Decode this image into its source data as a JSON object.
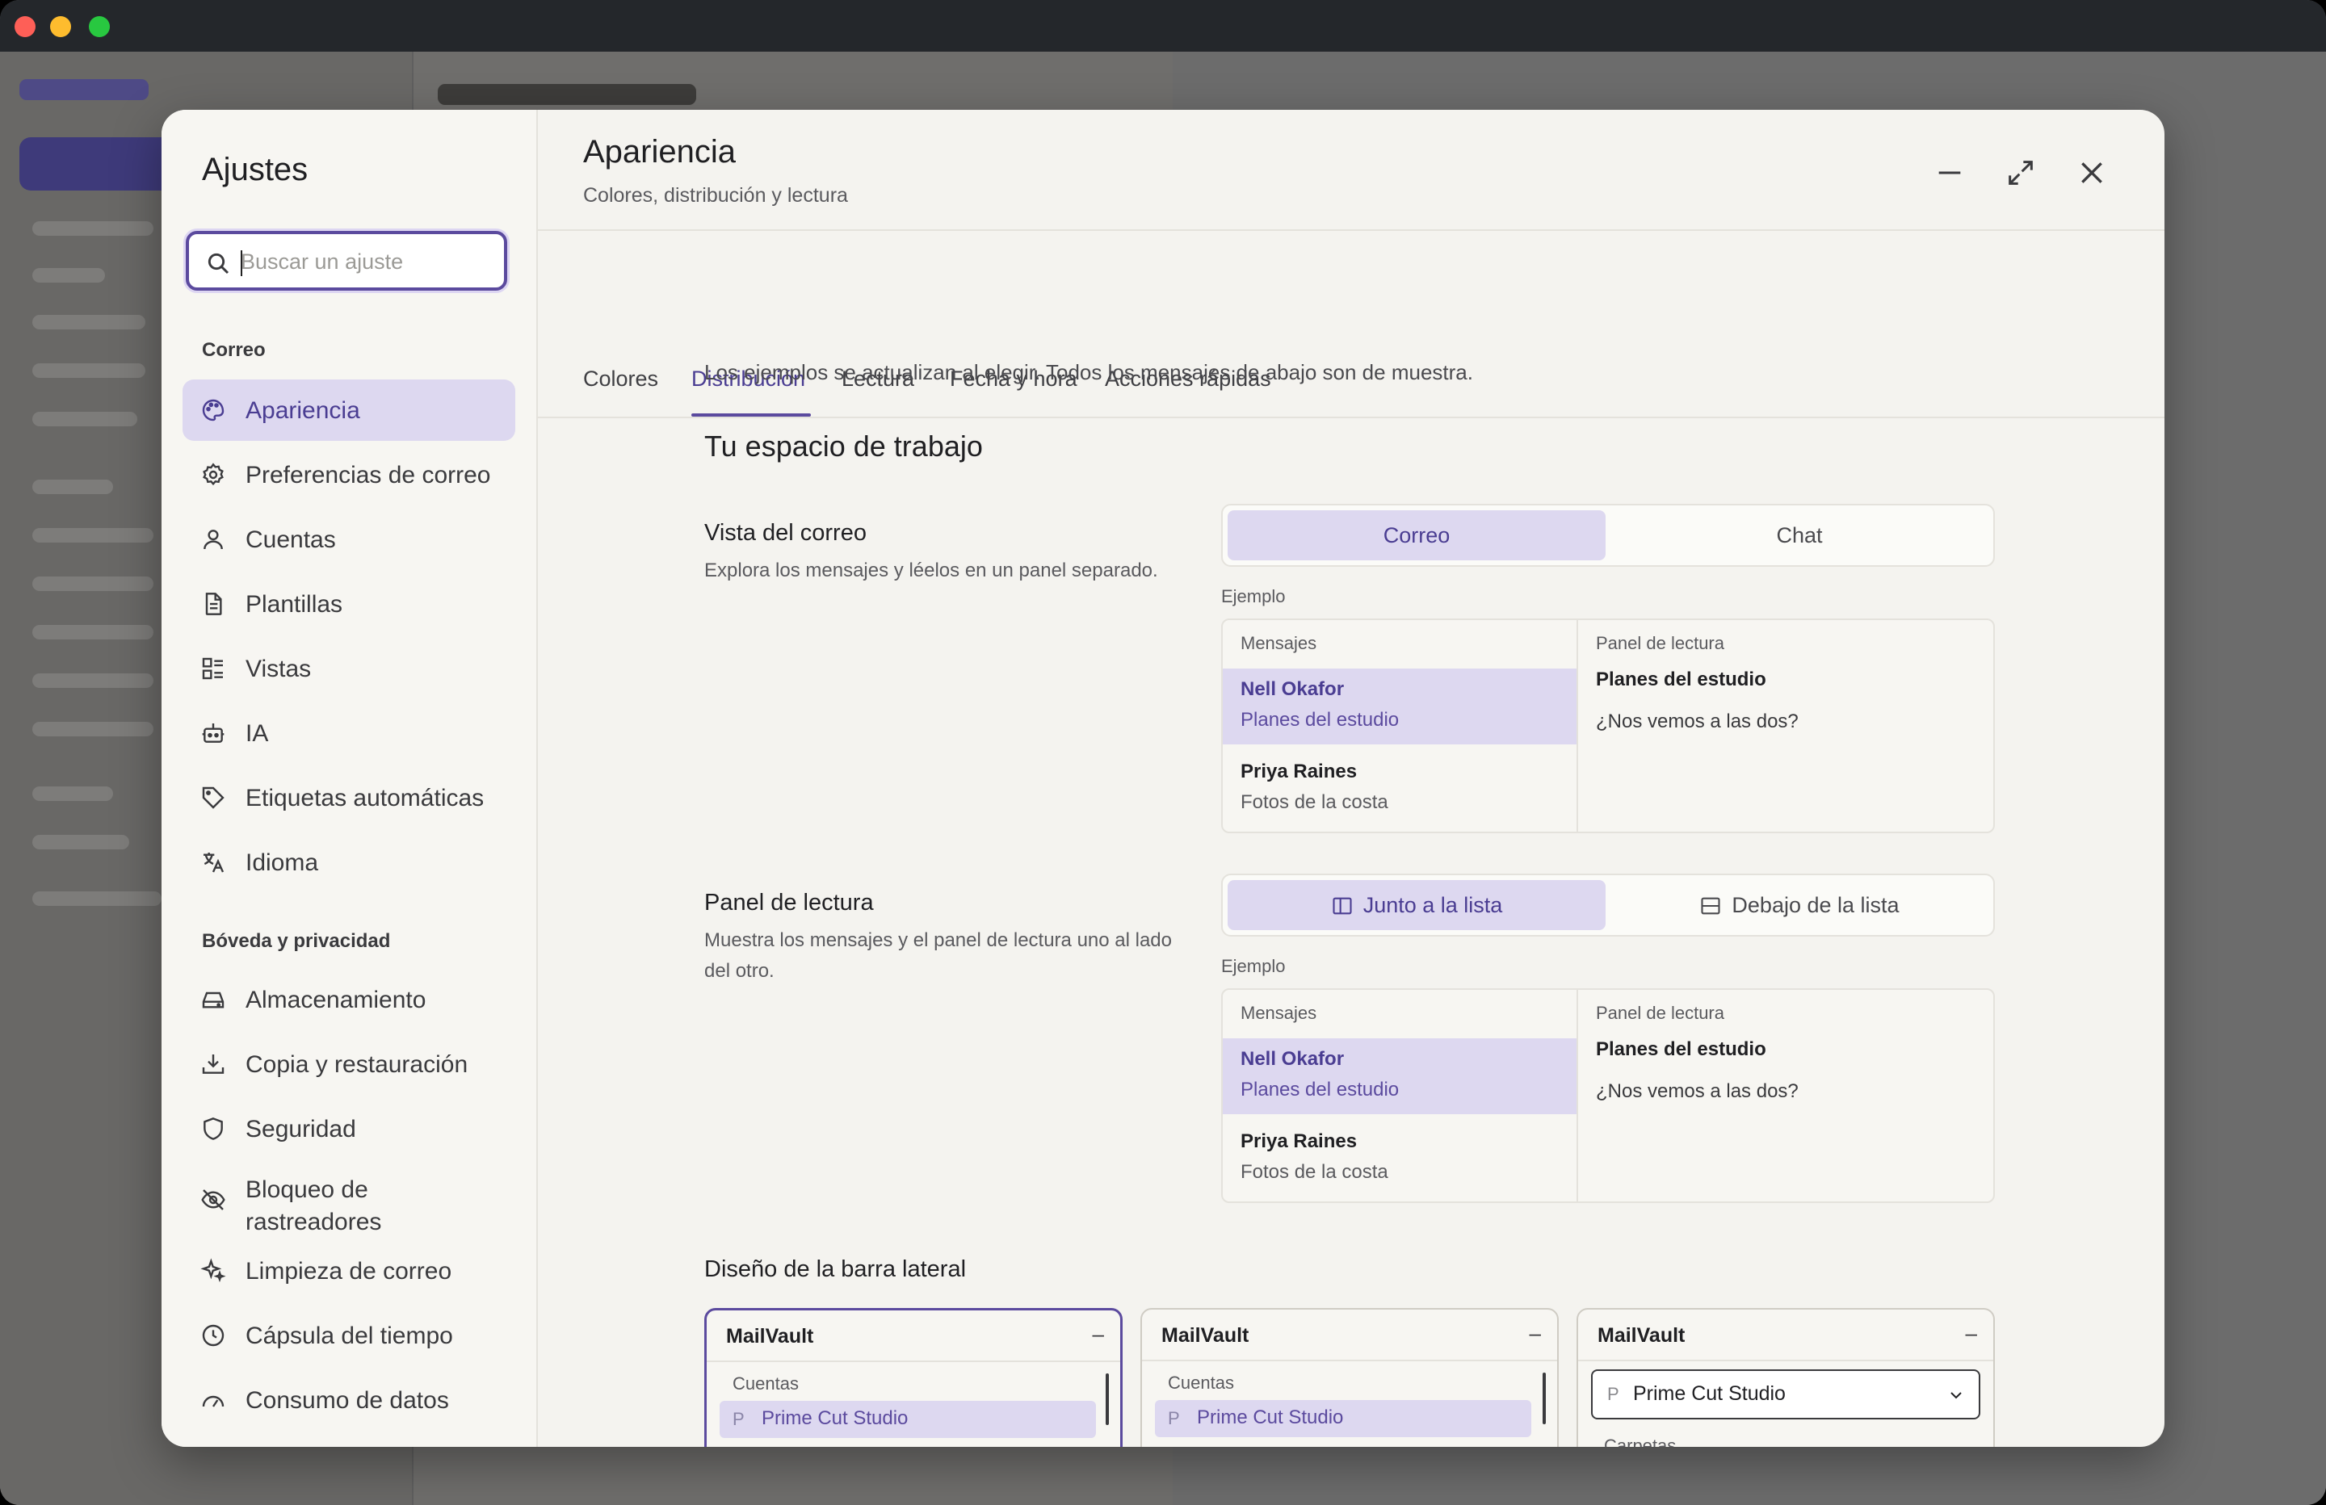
{
  "settings": {
    "title": "Ajustes",
    "search_placeholder": "Buscar un ajuste",
    "sections": [
      {
        "label": "Correo"
      },
      {
        "label": "Bóveda y privacidad"
      }
    ],
    "nav": [
      {
        "label": "Apariencia",
        "icon": "palette-icon",
        "active": true
      },
      {
        "label": "Preferencias de correo",
        "icon": "gear-icon"
      },
      {
        "label": "Cuentas",
        "icon": "user-icon"
      },
      {
        "label": "Plantillas",
        "icon": "document-icon"
      },
      {
        "label": "Vistas",
        "icon": "views-icon"
      },
      {
        "label": "IA",
        "icon": "robot-icon"
      },
      {
        "label": "Etiquetas automáticas",
        "icon": "tag-icon"
      },
      {
        "label": "Idioma",
        "icon": "translate-icon"
      },
      {
        "label": "Almacenamiento",
        "icon": "drive-icon"
      },
      {
        "label": "Copia y restauración",
        "icon": "download-icon"
      },
      {
        "label": "Seguridad",
        "icon": "shield-icon"
      },
      {
        "label": "Bloqueo de rastreadores",
        "icon": "eye-off-icon"
      },
      {
        "label": "Limpieza de correo",
        "icon": "sparkles-icon"
      },
      {
        "label": "Cápsula del tiempo",
        "icon": "clock-icon"
      },
      {
        "label": "Consumo de datos",
        "icon": "gauge-icon"
      }
    ]
  },
  "main": {
    "title": "Apariencia",
    "subtitle": "Colores, distribución y lectura",
    "tabs": [
      {
        "label": "Colores"
      },
      {
        "label": "Distribución",
        "active": true
      },
      {
        "label": "Lectura"
      },
      {
        "label": "Fecha y hora"
      },
      {
        "label": "Acciones rápidas"
      }
    ],
    "note": "Los ejemplos se actualizan al elegir. Todos los mensajes de abajo son de muestra.",
    "workspace_heading": "Tu espacio de trabajo",
    "mail_view": {
      "title": "Vista del correo",
      "description": "Explora los mensajes y léelos en un panel separado.",
      "options": [
        "Correo",
        "Chat"
      ],
      "selected": "Correo"
    },
    "reading_pane": {
      "title": "Panel de lectura",
      "description": "Muestra los mensajes y el panel de lectura uno al lado del otro.",
      "options": [
        "Junto a la lista",
        "Debajo de la lista"
      ],
      "selected": "Junto a la lista"
    },
    "example_label": "Ejemplo",
    "preview": {
      "messages_header": "Mensajes",
      "reading_header": "Panel de lectura",
      "rows": [
        {
          "name": "Nell Okafor",
          "subject": "Planes del estudio"
        },
        {
          "name": "Priya Raines",
          "subject": "Fotos de la costa"
        }
      ],
      "reading_title": "Planes del estudio",
      "reading_body": "¿Nos vemos a las dos?"
    },
    "sidebar_design": {
      "title": "Diseño de la barra lateral",
      "brand": "MailVault",
      "collapse": "–",
      "accounts_label": "Cuentas",
      "account_initial": "P",
      "account_name": "Prime Cut Studio",
      "folders_label": "Carpetas"
    }
  },
  "colors": {
    "accent": "#5b4a9e",
    "accent_soft": "#ddd8f0",
    "traffic_red": "#fe5f57",
    "traffic_yellow": "#febc2e",
    "traffic_green": "#28c840"
  }
}
